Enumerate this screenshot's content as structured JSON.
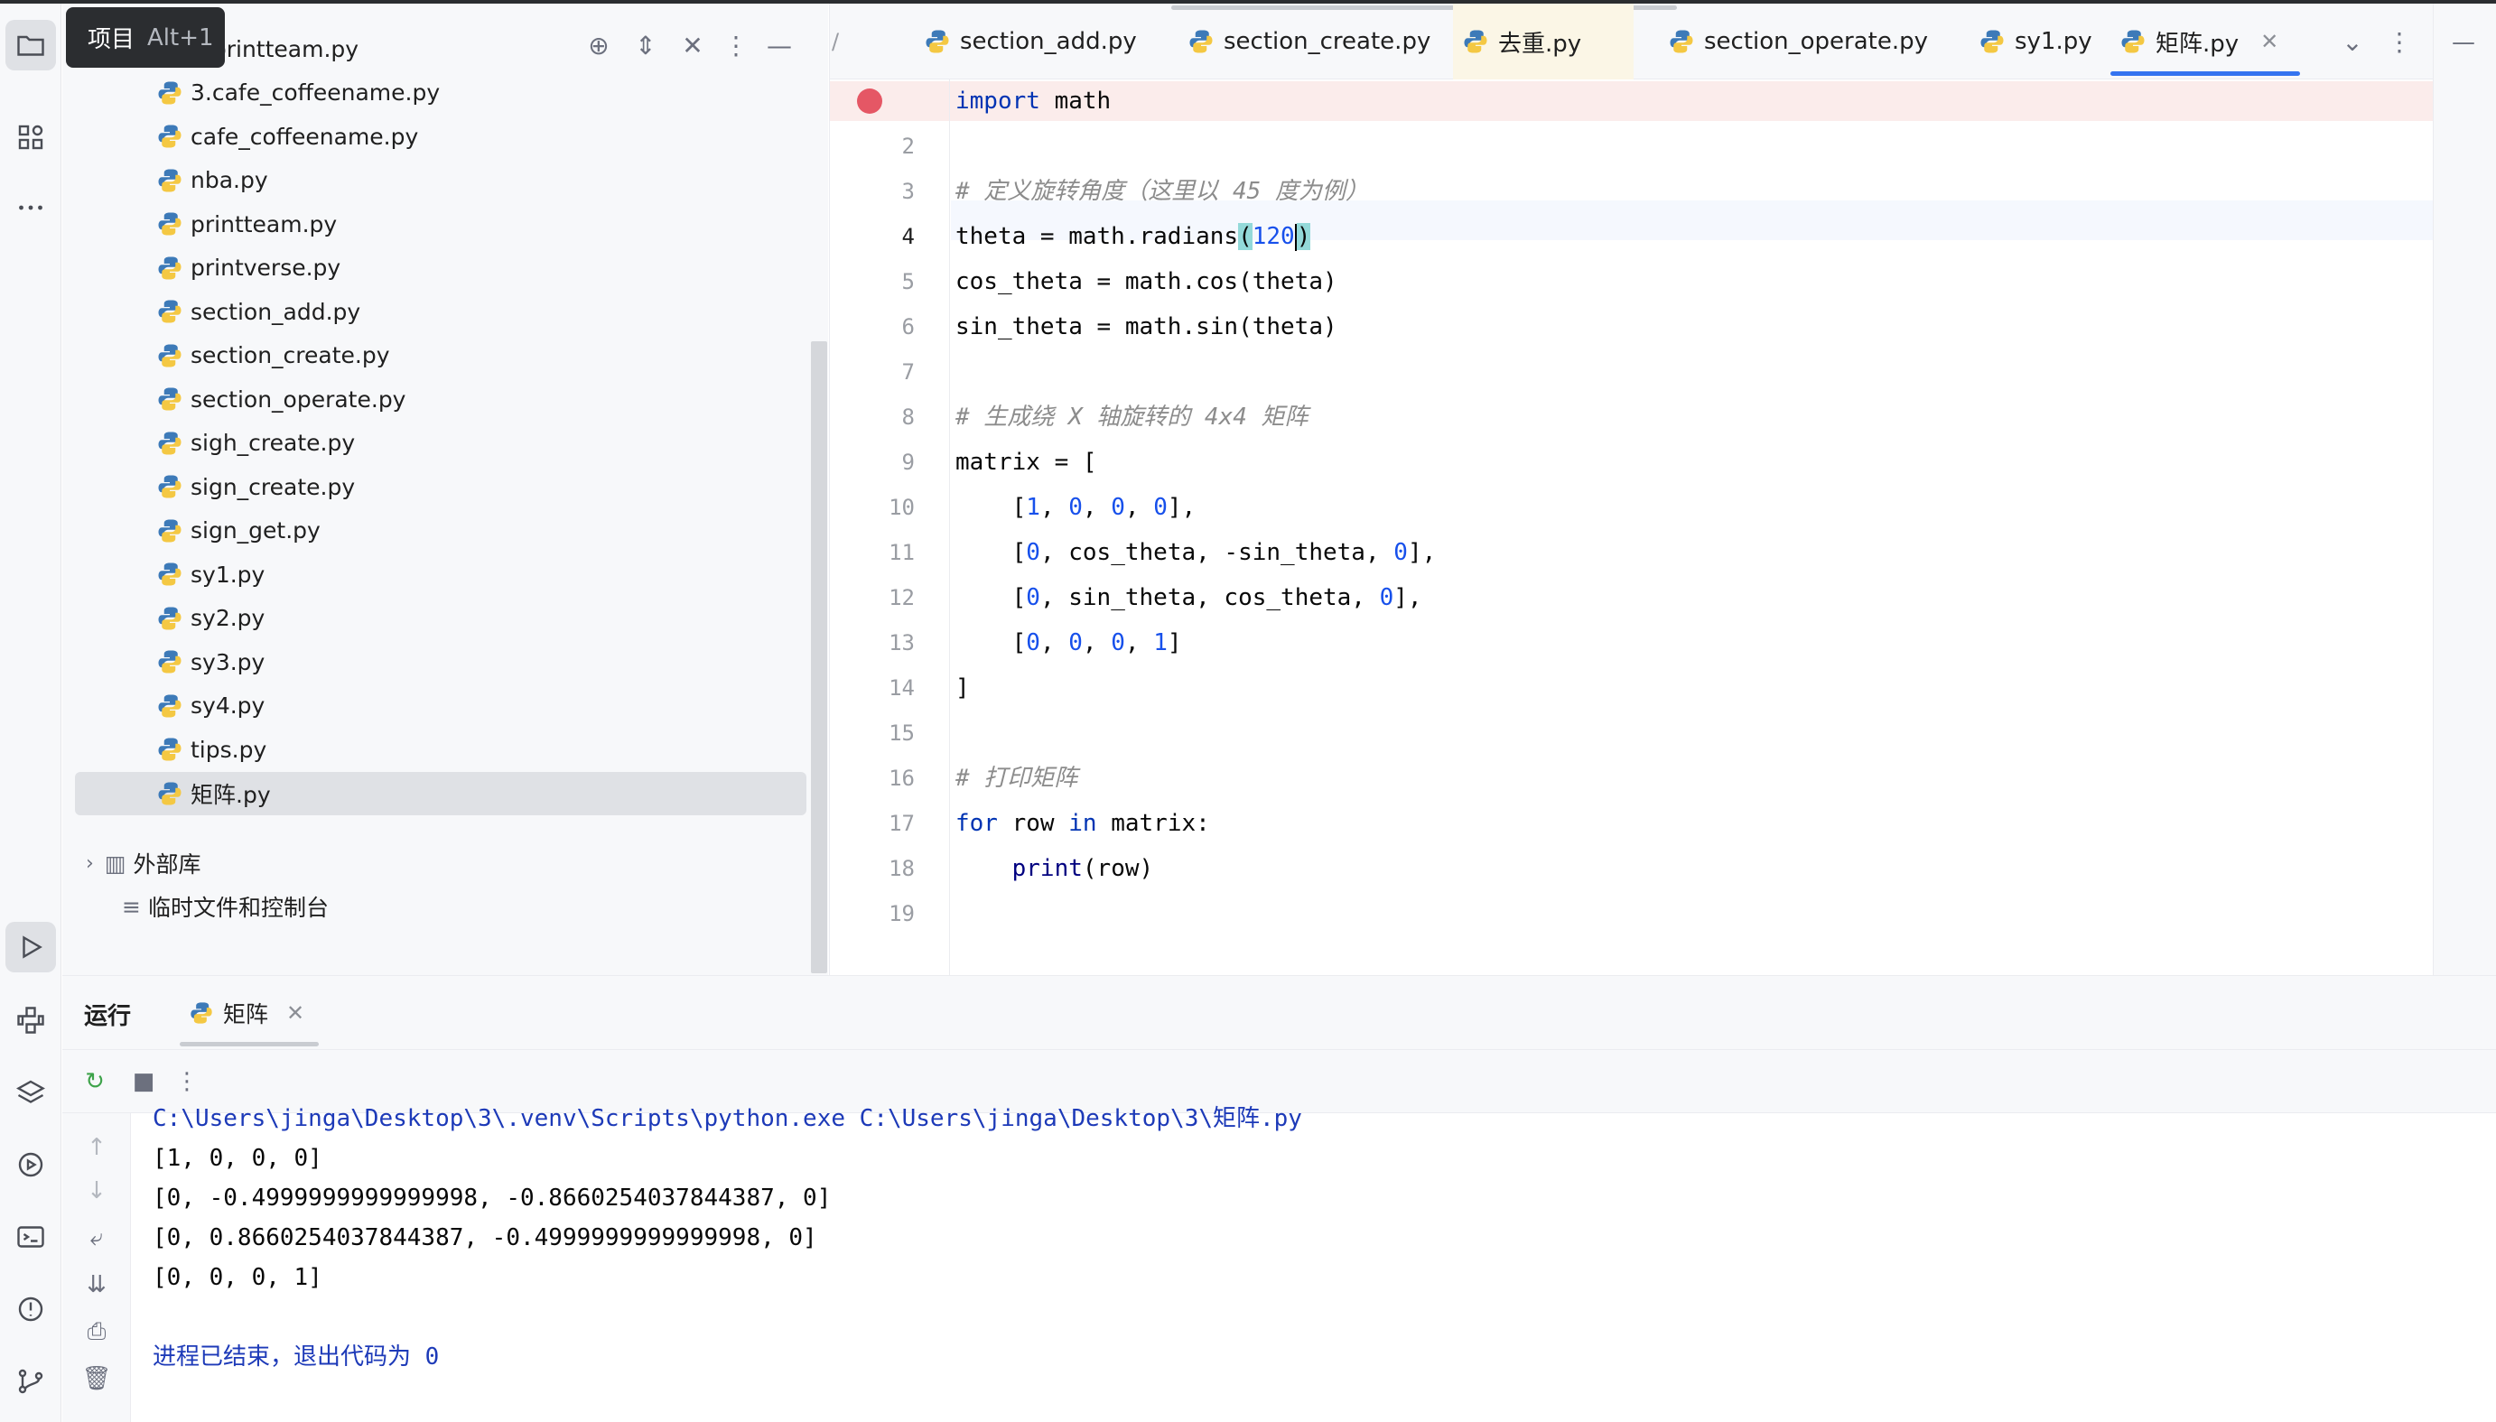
{
  "tooltip": {
    "label": "项目",
    "shortcut": "Alt+1"
  },
  "activity_bar": {
    "icons": [
      "folder-icon",
      "structure-icon",
      "more-icon",
      "run-icon",
      "python-console-icon",
      "layers-icon",
      "services-icon",
      "terminal-icon",
      "problems-icon",
      "git-icon"
    ]
  },
  "project_tree": {
    "files": [
      "2.printteam.py",
      "3.cafe_coffeename.py",
      "cafe_coffeename.py",
      "nba.py",
      "printteam.py",
      "printverse.py",
      "section_add.py",
      "section_create.py",
      "section_operate.py",
      "sigh_create.py",
      "sign_create.py",
      "sign_get.py",
      "sy1.py",
      "sy2.py",
      "sy3.py",
      "sy4.py",
      "tips.py",
      "矩阵.py"
    ],
    "selected": "矩阵.py",
    "external_libs": "外部库",
    "scratches": "临时文件和控制台"
  },
  "tabs": [
    {
      "label": "section_add.py"
    },
    {
      "label": "section_create.py"
    },
    {
      "label": "去重.py"
    },
    {
      "label": "section_operate.py"
    },
    {
      "label": "sy1.py"
    },
    {
      "label": "矩阵.py",
      "active": true
    }
  ],
  "editor": {
    "current_line": 4,
    "breakpoint_line": 1,
    "lines": [
      "import math",
      "",
      "# 定义旋转角度（这里以 45 度为例）",
      "theta = math.radians(120)",
      "cos_theta = math.cos(theta)",
      "sin_theta = math.sin(theta)",
      "",
      "# 生成绕 X 轴旋转的 4x4 矩阵",
      "matrix = [",
      "    [1, 0, 0, 0],",
      "    [0, cos_theta, -sin_theta, 0],",
      "    [0, sin_theta, cos_theta, 0],",
      "    [0, 0, 0, 1]",
      "]",
      "",
      "# 打印矩阵",
      "for row in matrix:",
      "    print(row)",
      ""
    ]
  },
  "run_panel": {
    "title": "运行",
    "tab_label": "矩阵",
    "console": {
      "command": "C:\\Users\\jinga\\Desktop\\3\\.venv\\Scripts\\python.exe C:\\Users\\jinga\\Desktop\\3\\矩阵.py",
      "output": [
        "[1, 0, 0, 0]",
        "[0, -0.4999999999999998, -0.8660254037844387, 0]",
        "[0, 0.8660254037844387, -0.4999999999999998, 0]",
        "[0, 0, 0, 1]"
      ],
      "exit_message": "进程已结束，退出代码为 0"
    }
  },
  "colors": {
    "accent": "#3574f0",
    "breakpoint": "#e55765",
    "keyword": "#0033b3",
    "number": "#1750eb",
    "comment": "#8c8c8c"
  }
}
